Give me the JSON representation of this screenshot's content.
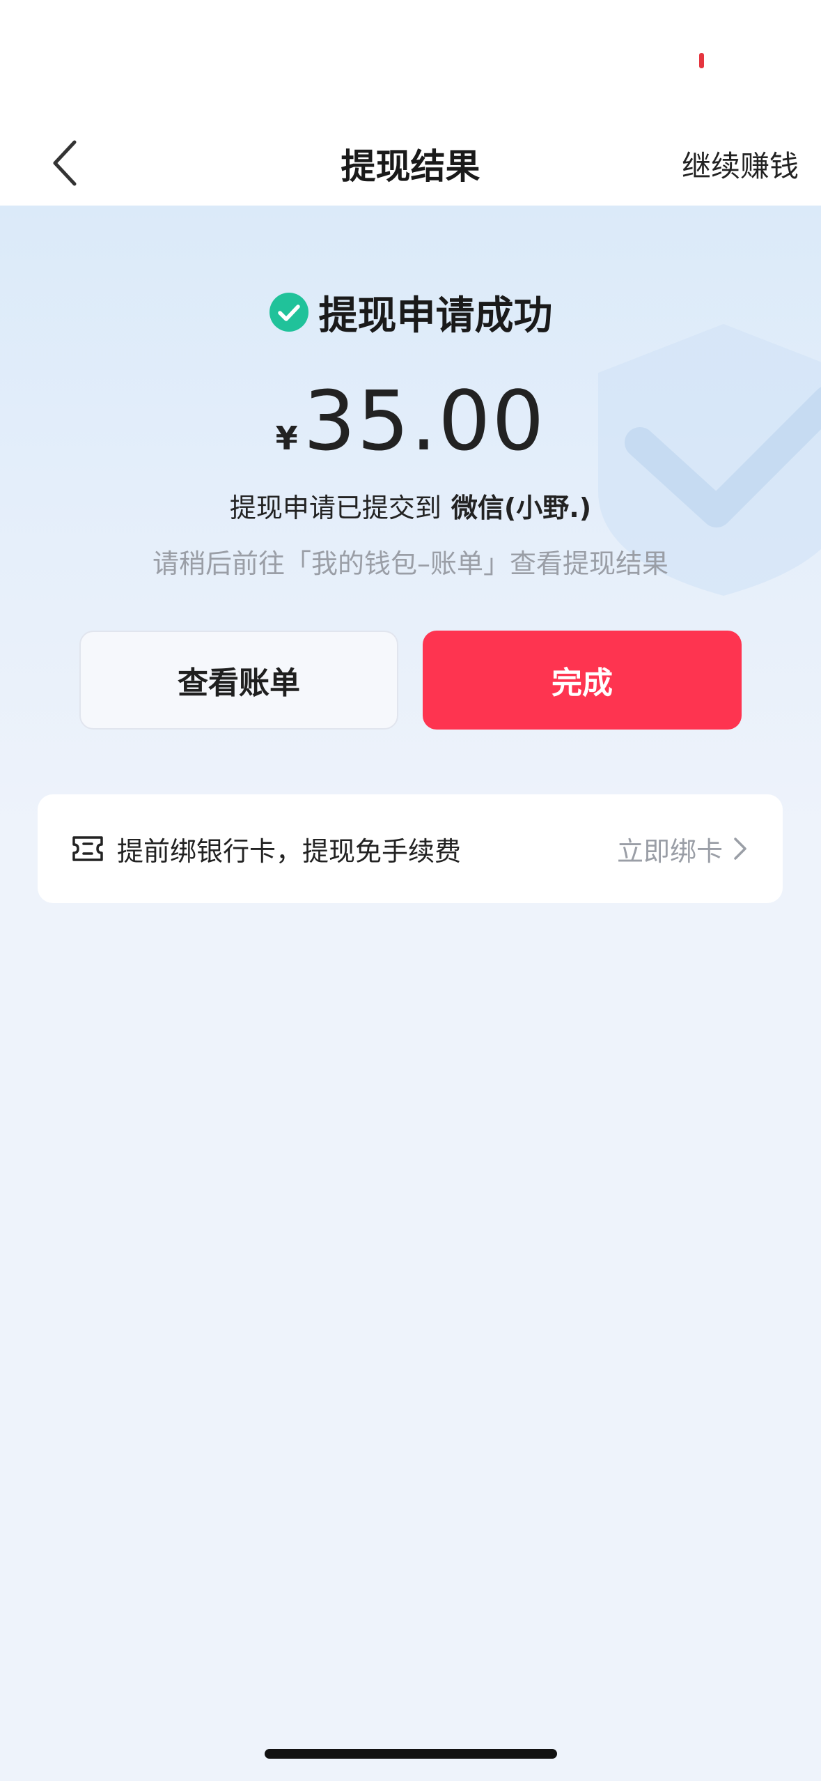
{
  "nav": {
    "title": "提现结果",
    "action_label": "继续赚钱",
    "back_icon": "chevron-left-icon"
  },
  "result": {
    "status_text": "提现申请成功",
    "status_icon": "check-circle-icon",
    "currency_symbol": "¥",
    "amount": "35.00",
    "submit_prefix": "提现申请已提交到",
    "submit_target": "微信(小野.)",
    "hint": "请稍后前往「我的钱包–账单」查看提现结果"
  },
  "buttons": {
    "view_bill_label": "查看账单",
    "done_label": "完成"
  },
  "bank_prompt": {
    "text": "提前绑银行卡，提现免手续费",
    "link_label": "立即绑卡",
    "icon": "ticket-icon"
  },
  "colors": {
    "accent_red": "#fe3450",
    "success_green": "#20c29a",
    "muted_text": "#9a9ea6",
    "primary_text": "#222222"
  }
}
